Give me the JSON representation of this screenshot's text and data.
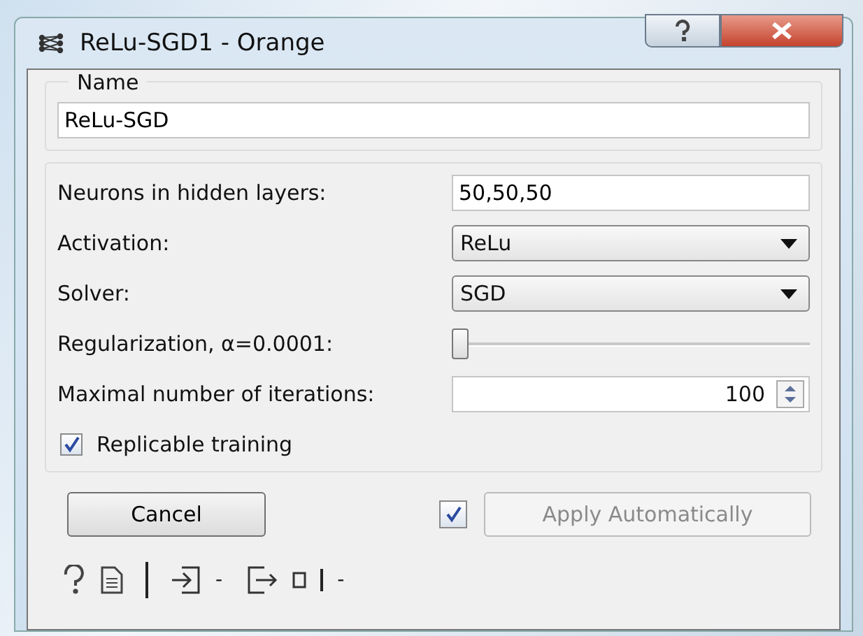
{
  "window": {
    "title": "ReLu-SGD1 - Orange"
  },
  "name_box": {
    "title": "Name",
    "value": "ReLu-SGD"
  },
  "params": [
    {
      "kind": "text",
      "label": "Neurons in hidden layers:",
      "value": "50,50,50"
    },
    {
      "kind": "combo",
      "label": "Activation:",
      "value": "ReLu"
    },
    {
      "kind": "combo",
      "label": "Solver:",
      "value": "SGD"
    },
    {
      "kind": "slider",
      "label": "Regularization, α=0.0001:",
      "level": 0.0
    },
    {
      "kind": "spin",
      "label": "Maximal number of iterations:",
      "value": "100"
    }
  ],
  "replicable": {
    "label": "Replicable training",
    "checked": true
  },
  "cancel_button": "Cancel",
  "auto_apply": {
    "checked": true,
    "label": "Apply Automatically",
    "disabled": true
  },
  "status_bar": {
    "input_summary": "-",
    "output_summary": "-"
  }
}
